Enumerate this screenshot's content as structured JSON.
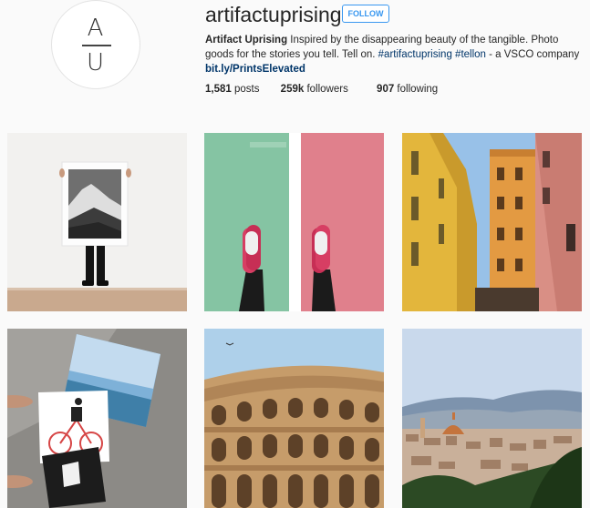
{
  "profile": {
    "avatar_top": "A",
    "avatar_bottom": "U",
    "username": "artifactuprising",
    "follow_label": "FOLLOW",
    "bio": {
      "name": "Artifact Uprising",
      "text1": " Inspired by the disappearing beauty of the tangible. Photo goods for the stories you tell. Tell on. ",
      "tag1": "#artifactuprising",
      "space": " ",
      "tag2": "#tellon",
      "text2": " - a VSCO company",
      "link": "bit.ly/PrintsElevated"
    },
    "stats": {
      "posts_count": "1,581",
      "posts_label": " posts",
      "followers_count": "259k",
      "followers_label": " followers",
      "following_count": "907",
      "following_label": " following"
    }
  },
  "posts": [
    {
      "subject": "person-holding-mountain-print",
      "accent": "#c4a083"
    },
    {
      "subject": "red-sneakers-on-green-and-red-floor",
      "accent": "#e07480"
    },
    {
      "subject": "italian-street-buildings",
      "accent": "#d89a3c"
    },
    {
      "subject": "hands-holding-prints-on-concrete",
      "accent": "#8f8b85"
    },
    {
      "subject": "colosseum",
      "accent": "#c49a66"
    },
    {
      "subject": "florence-skyline",
      "accent": "#b68a6a"
    }
  ]
}
